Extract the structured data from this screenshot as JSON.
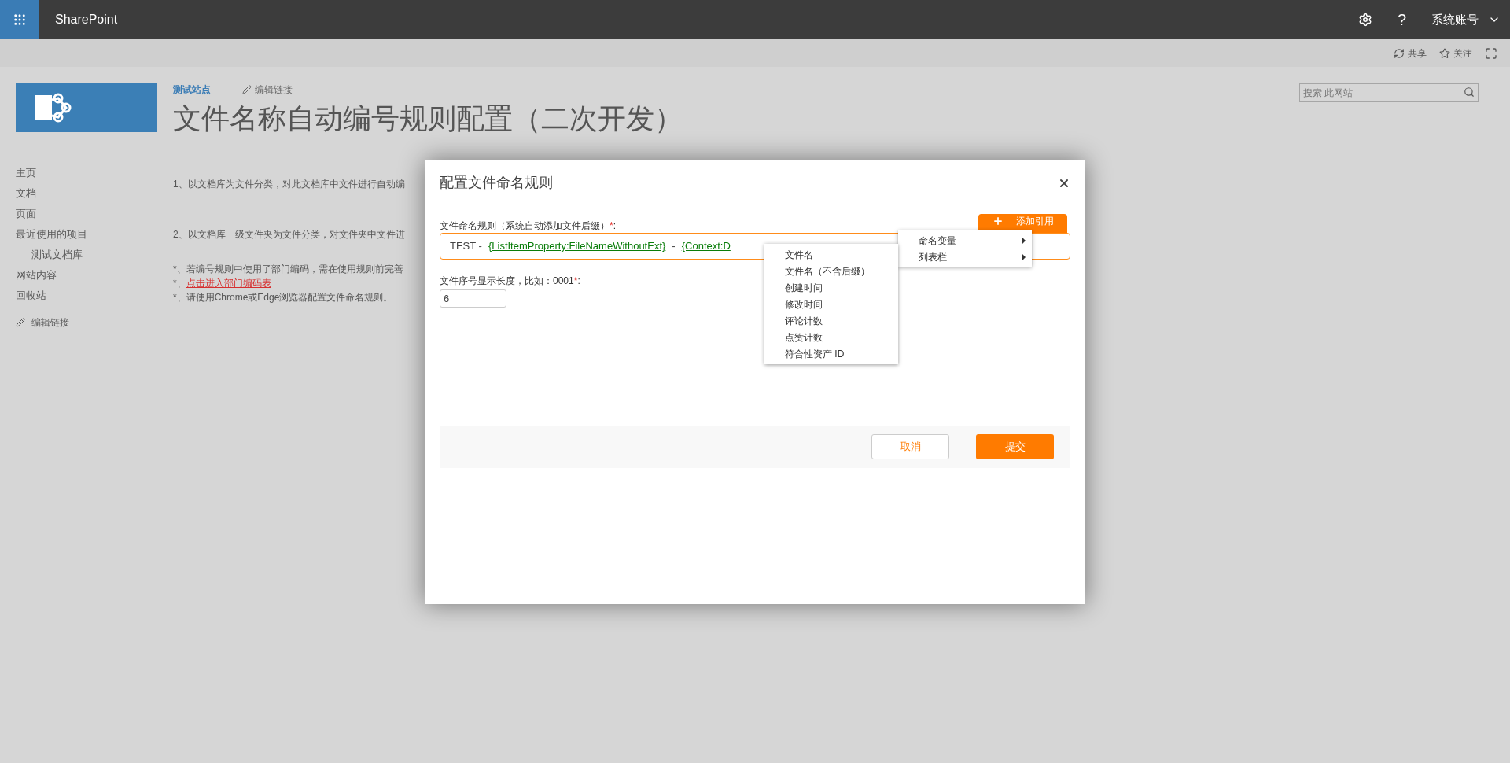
{
  "top_bar": {
    "brand": "SharePoint",
    "help": "?",
    "account": "系统账号"
  },
  "actions": [
    {
      "kind": "share",
      "label": "共享"
    },
    {
      "kind": "follow",
      "label": "关注"
    },
    {
      "kind": "focus"
    }
  ],
  "site": {
    "name": "测试站点",
    "edit_link": "编辑链接",
    "title": "文件名称自动编号规则配置（二次开发）"
  },
  "search": {
    "placeholder": "搜索 此网站"
  },
  "nav": [
    {
      "label": "主页"
    },
    {
      "label": "文档"
    },
    {
      "label": "页面"
    },
    {
      "label": "最近使用的项目",
      "children": [
        {
          "label": "测试文档库"
        }
      ]
    },
    {
      "label": "网站内容"
    },
    {
      "label": "回收站"
    }
  ],
  "nav_edit_link": "编辑链接",
  "notes": [
    {
      "kind": "text",
      "text": "1、以文档库为文件分类，对此文档库中文件进行自动编"
    },
    {
      "kind": "text",
      "text": "2、以文档库一级文件夹为文件分类，对文件夹中文件进"
    },
    {
      "kind": "text",
      "text": "*、若编号规则中使用了部门编码，需在使用规则前完善"
    },
    {
      "kind": "link",
      "prefix": "*、",
      "text": "点击进入部门编码表"
    },
    {
      "kind": "text",
      "text": "*、请使用Chrome或Edge浏览器配置文件命名规则。"
    }
  ],
  "dialog": {
    "title": "配置文件命名规则",
    "rule_label": "文件命名规则（系统自动添加文件后缀）",
    "rule_required": true,
    "required_mark": "*",
    "label_suffix": ":",
    "rule_parts": [
      {
        "kind": "text",
        "text": "TEST -"
      },
      {
        "kind": "token",
        "text": "{ListItemProperty:FileNameWithoutExt}"
      },
      {
        "kind": "text",
        "text": "-"
      },
      {
        "kind": "token",
        "text": "{Context:D"
      }
    ],
    "add_reference": "添加引用",
    "length_label": "文件序号显示长度，比如：0001",
    "length_required": true,
    "length_value": "6",
    "buttons": [
      {
        "kind": "secondary",
        "label": "取消"
      },
      {
        "kind": "primary",
        "label": "提交"
      }
    ]
  },
  "menu": [
    {
      "label": "命名变量",
      "submenu": true
    },
    {
      "label": "列表栏",
      "submenu": true
    }
  ],
  "submenu": [
    "文件名",
    "文件名（不含后缀）",
    "创建时间",
    "修改时间",
    "评论计数",
    "点赞计数",
    "符合性资产 ID"
  ]
}
